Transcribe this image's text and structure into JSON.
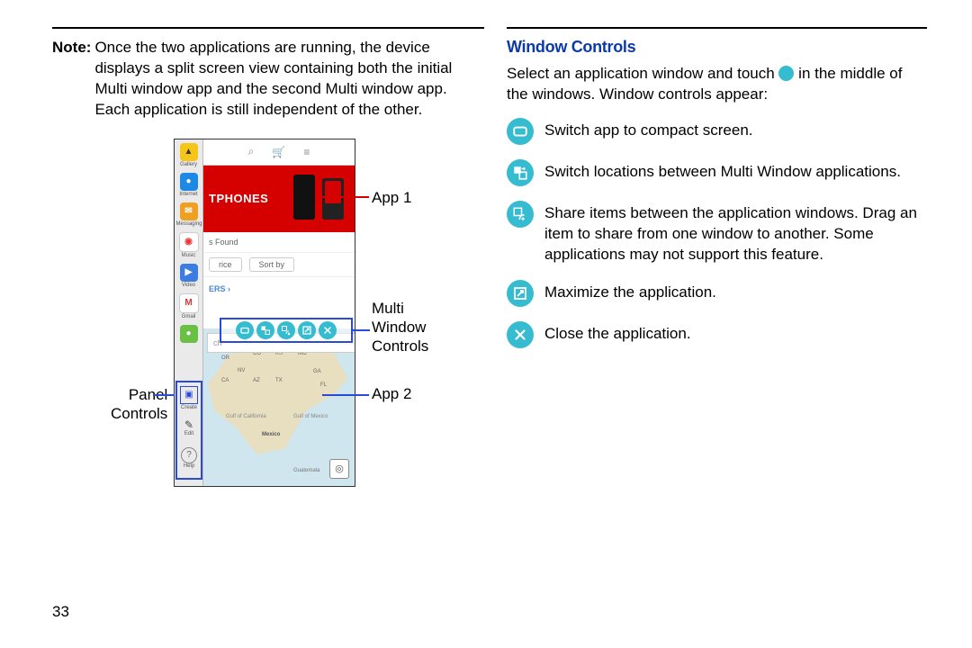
{
  "page_number": "33",
  "note_label": "Note:",
  "note_text": "Once the two applications are running, the device displays a split screen view containing both the initial Multi window app and the second Multi window app. Each application is still independent of the other.",
  "callouts": {
    "app1": "App 1",
    "multi_window_controls": "Multi\nWindow\nControls",
    "app2": "App 2",
    "panel_controls": "Panel\nControls"
  },
  "header_window_controls": "Window Controls",
  "intro_pre": "Select an application window and touch ",
  "intro_post": " in the middle of the windows. Window controls appear:",
  "controls": {
    "compact": "Switch app to compact screen.",
    "swap": "Switch locations between Multi Window applications.",
    "share": "Share items between the application windows. Drag an item to share from one window to another. Some applications may not support this feature.",
    "maximize": "Maximize the application.",
    "close": "Close the application."
  },
  "phone": {
    "tray_labels": [
      "Gallery",
      "Internet",
      "Messaging",
      "Music",
      "Video",
      "Gmail"
    ],
    "hero_text": "TPHONES",
    "found_text": "s Found",
    "filter1": "rice",
    "filter2": "Sort by",
    "search_placeholder": "ch",
    "panel_items": [
      "Create",
      "Edit",
      "Help"
    ]
  }
}
